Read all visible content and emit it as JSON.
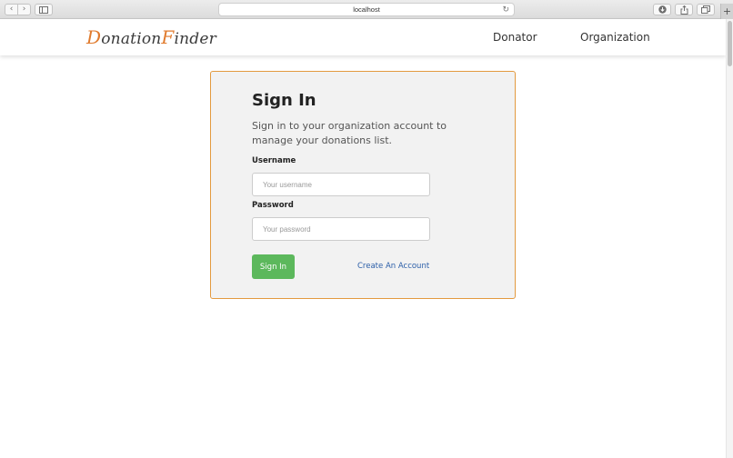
{
  "browser": {
    "url": "localhost",
    "icons": {
      "back": "chevron-left-icon",
      "forward": "chevron-right-icon",
      "sidebar": "sidebar-icon",
      "reload": "reload-icon",
      "download": "download-icon",
      "share": "share-icon",
      "tabs": "tabs-icon",
      "new_tab": "plus-icon"
    }
  },
  "header": {
    "logo_cap1": "D",
    "logo_part1": "onation",
    "logo_cap2": "F",
    "logo_part2": "inder",
    "nav": [
      "Donator",
      "Organization"
    ]
  },
  "signin": {
    "title": "Sign In",
    "subtitle": "Sign in to your organization account to manage your donations list.",
    "username_label": "Username",
    "username_placeholder": "Your username",
    "username_value": "",
    "password_label": "Password",
    "password_placeholder": "Your password",
    "password_value": "",
    "submit_label": "Sign In",
    "create_account_label": "Create An Account"
  },
  "colors": {
    "accent_orange": "#e39a3f",
    "logo_orange": "#e07a2c",
    "button_green": "#5cb85c",
    "link_blue": "#2b5ea8",
    "card_bg": "#f2f2f2"
  }
}
